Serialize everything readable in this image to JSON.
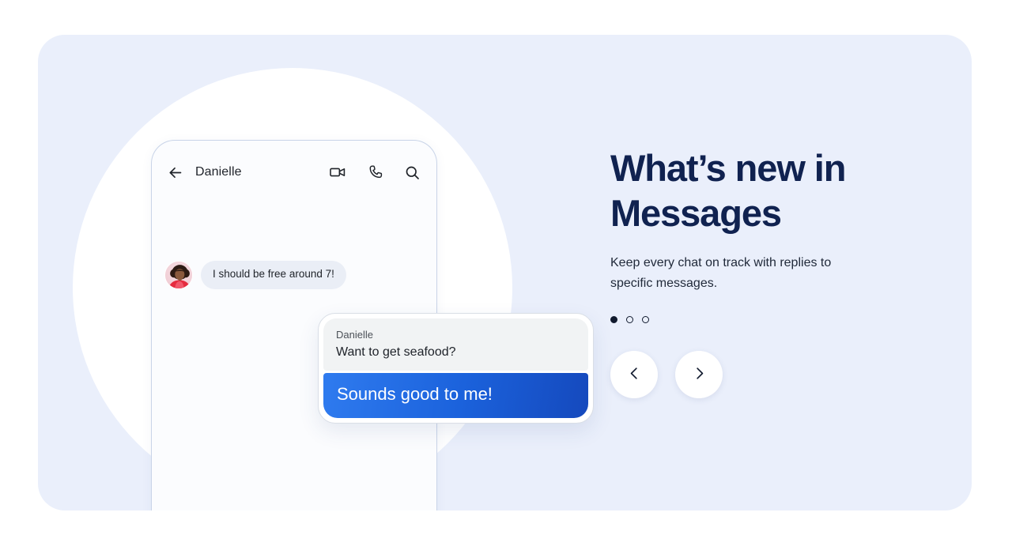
{
  "card": {
    "background_color": "#eaeffb",
    "circle_color": "#ffffff"
  },
  "phone": {
    "header": {
      "back_icon": "arrow-left-icon",
      "contact_name": "Danielle",
      "actions": [
        {
          "icon": "video-call-icon",
          "label": "Video call"
        },
        {
          "icon": "phone-call-icon",
          "label": "Voice call"
        },
        {
          "icon": "search-icon",
          "label": "Search"
        }
      ]
    },
    "conversation": {
      "incoming_message": {
        "avatar": "contact-avatar",
        "text": "I should be free around 7!"
      },
      "reply_card": {
        "quoted_sender": "Danielle",
        "quoted_text": "Want to get seafood?",
        "reply_text": "Sounds good to me!",
        "reply_bubble_color": "#1b62dc"
      }
    }
  },
  "info": {
    "headline": "What’s new in Messages",
    "subhead": "Keep every chat on track with replies to specific messages.",
    "headline_color": "#102250"
  },
  "carousel": {
    "dots": [
      {
        "active": true
      },
      {
        "active": false
      },
      {
        "active": false
      }
    ],
    "prev_label": "Previous",
    "next_label": "Next",
    "prev_icon": "chevron-left-icon",
    "next_icon": "chevron-right-icon"
  }
}
